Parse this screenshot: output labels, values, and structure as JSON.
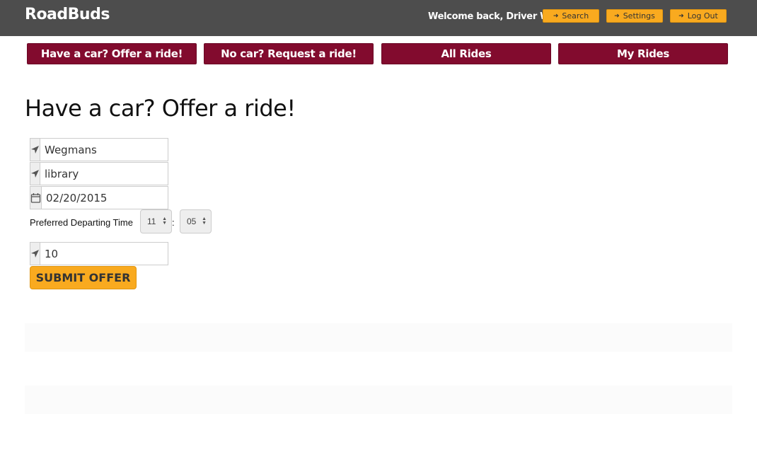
{
  "app": {
    "brand": "RoadBuds"
  },
  "header": {
    "welcome": "Welcome back, Driver Woo!",
    "search_label": "Search",
    "settings_label": "Settings",
    "logout_label": "Log Out"
  },
  "nav": {
    "offer": "Have a car? Offer a ride!",
    "request": "No car? Request a ride!",
    "all": "All Rides",
    "mine": "My Rides"
  },
  "main": {
    "title": "Have a car? Offer a ride!",
    "form": {
      "from_value": "Wegmans",
      "to_value": "library",
      "date_value": "02/20/2015",
      "time_label": "Preferred Departing Time",
      "hour": "11",
      "time_separator": ":",
      "minute": "05",
      "seats_value": "10",
      "submit_label": "SUBMIT OFFER"
    }
  },
  "colors": {
    "topbar": "#4d4d4d",
    "accent": "#f9aa1f",
    "nav": "#820b2e"
  }
}
